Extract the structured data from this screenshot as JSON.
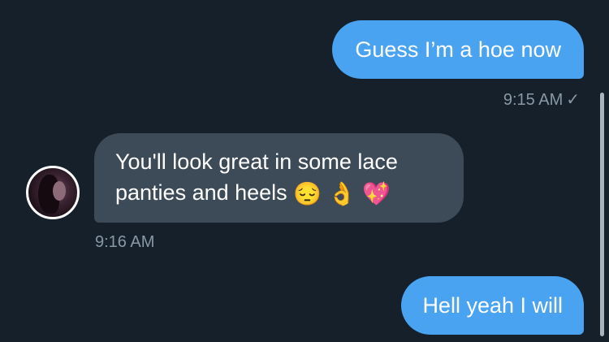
{
  "messages": [
    {
      "text": "Guess I’m a hoe now",
      "time": "9:15 AM",
      "status": "✓"
    },
    {
      "text": "You'll look great in some lace panties and heels",
      "emojis": [
        "😔",
        "👌",
        "💖"
      ],
      "time": "9:16 AM"
    },
    {
      "text": "Hell yeah I will"
    }
  ],
  "colors": {
    "background": "#15202b",
    "outgoing_bubble": "#4aa3f0",
    "incoming_bubble": "#3d4a57",
    "timestamp": "#8899a6"
  }
}
